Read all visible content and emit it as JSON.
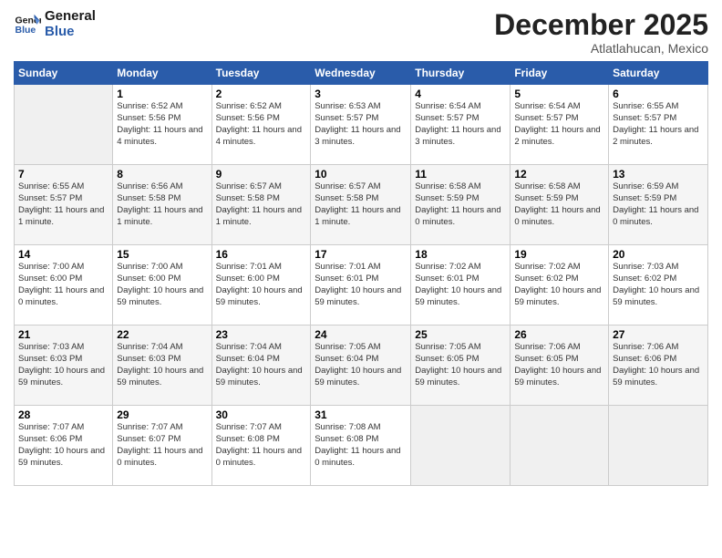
{
  "logo": {
    "line1": "General",
    "line2": "Blue"
  },
  "title": "December 2025",
  "subtitle": "Atlatlahucan, Mexico",
  "days_header": [
    "Sunday",
    "Monday",
    "Tuesday",
    "Wednesday",
    "Thursday",
    "Friday",
    "Saturday"
  ],
  "weeks": [
    [
      {
        "day": "",
        "sunrise": "",
        "sunset": "",
        "daylight": "",
        "empty": true
      },
      {
        "day": "1",
        "sunrise": "6:52 AM",
        "sunset": "5:56 PM",
        "daylight": "11 hours and 4 minutes.",
        "empty": false
      },
      {
        "day": "2",
        "sunrise": "6:52 AM",
        "sunset": "5:56 PM",
        "daylight": "11 hours and 4 minutes.",
        "empty": false
      },
      {
        "day": "3",
        "sunrise": "6:53 AM",
        "sunset": "5:57 PM",
        "daylight": "11 hours and 3 minutes.",
        "empty": false
      },
      {
        "day": "4",
        "sunrise": "6:54 AM",
        "sunset": "5:57 PM",
        "daylight": "11 hours and 3 minutes.",
        "empty": false
      },
      {
        "day": "5",
        "sunrise": "6:54 AM",
        "sunset": "5:57 PM",
        "daylight": "11 hours and 2 minutes.",
        "empty": false
      },
      {
        "day": "6",
        "sunrise": "6:55 AM",
        "sunset": "5:57 PM",
        "daylight": "11 hours and 2 minutes.",
        "empty": false
      }
    ],
    [
      {
        "day": "7",
        "sunrise": "6:55 AM",
        "sunset": "5:57 PM",
        "daylight": "11 hours and 1 minute.",
        "empty": false
      },
      {
        "day": "8",
        "sunrise": "6:56 AM",
        "sunset": "5:58 PM",
        "daylight": "11 hours and 1 minute.",
        "empty": false
      },
      {
        "day": "9",
        "sunrise": "6:57 AM",
        "sunset": "5:58 PM",
        "daylight": "11 hours and 1 minute.",
        "empty": false
      },
      {
        "day": "10",
        "sunrise": "6:57 AM",
        "sunset": "5:58 PM",
        "daylight": "11 hours and 1 minute.",
        "empty": false
      },
      {
        "day": "11",
        "sunrise": "6:58 AM",
        "sunset": "5:59 PM",
        "daylight": "11 hours and 0 minutes.",
        "empty": false
      },
      {
        "day": "12",
        "sunrise": "6:58 AM",
        "sunset": "5:59 PM",
        "daylight": "11 hours and 0 minutes.",
        "empty": false
      },
      {
        "day": "13",
        "sunrise": "6:59 AM",
        "sunset": "5:59 PM",
        "daylight": "11 hours and 0 minutes.",
        "empty": false
      }
    ],
    [
      {
        "day": "14",
        "sunrise": "7:00 AM",
        "sunset": "6:00 PM",
        "daylight": "11 hours and 0 minutes.",
        "empty": false
      },
      {
        "day": "15",
        "sunrise": "7:00 AM",
        "sunset": "6:00 PM",
        "daylight": "10 hours and 59 minutes.",
        "empty": false
      },
      {
        "day": "16",
        "sunrise": "7:01 AM",
        "sunset": "6:00 PM",
        "daylight": "10 hours and 59 minutes.",
        "empty": false
      },
      {
        "day": "17",
        "sunrise": "7:01 AM",
        "sunset": "6:01 PM",
        "daylight": "10 hours and 59 minutes.",
        "empty": false
      },
      {
        "day": "18",
        "sunrise": "7:02 AM",
        "sunset": "6:01 PM",
        "daylight": "10 hours and 59 minutes.",
        "empty": false
      },
      {
        "day": "19",
        "sunrise": "7:02 AM",
        "sunset": "6:02 PM",
        "daylight": "10 hours and 59 minutes.",
        "empty": false
      },
      {
        "day": "20",
        "sunrise": "7:03 AM",
        "sunset": "6:02 PM",
        "daylight": "10 hours and 59 minutes.",
        "empty": false
      }
    ],
    [
      {
        "day": "21",
        "sunrise": "7:03 AM",
        "sunset": "6:03 PM",
        "daylight": "10 hours and 59 minutes.",
        "empty": false
      },
      {
        "day": "22",
        "sunrise": "7:04 AM",
        "sunset": "6:03 PM",
        "daylight": "10 hours and 59 minutes.",
        "empty": false
      },
      {
        "day": "23",
        "sunrise": "7:04 AM",
        "sunset": "6:04 PM",
        "daylight": "10 hours and 59 minutes.",
        "empty": false
      },
      {
        "day": "24",
        "sunrise": "7:05 AM",
        "sunset": "6:04 PM",
        "daylight": "10 hours and 59 minutes.",
        "empty": false
      },
      {
        "day": "25",
        "sunrise": "7:05 AM",
        "sunset": "6:05 PM",
        "daylight": "10 hours and 59 minutes.",
        "empty": false
      },
      {
        "day": "26",
        "sunrise": "7:06 AM",
        "sunset": "6:05 PM",
        "daylight": "10 hours and 59 minutes.",
        "empty": false
      },
      {
        "day": "27",
        "sunrise": "7:06 AM",
        "sunset": "6:06 PM",
        "daylight": "10 hours and 59 minutes.",
        "empty": false
      }
    ],
    [
      {
        "day": "28",
        "sunrise": "7:07 AM",
        "sunset": "6:06 PM",
        "daylight": "10 hours and 59 minutes.",
        "empty": false
      },
      {
        "day": "29",
        "sunrise": "7:07 AM",
        "sunset": "6:07 PM",
        "daylight": "11 hours and 0 minutes.",
        "empty": false
      },
      {
        "day": "30",
        "sunrise": "7:07 AM",
        "sunset": "6:08 PM",
        "daylight": "11 hours and 0 minutes.",
        "empty": false
      },
      {
        "day": "31",
        "sunrise": "7:08 AM",
        "sunset": "6:08 PM",
        "daylight": "11 hours and 0 minutes.",
        "empty": false
      },
      {
        "day": "",
        "sunrise": "",
        "sunset": "",
        "daylight": "",
        "empty": true
      },
      {
        "day": "",
        "sunrise": "",
        "sunset": "",
        "daylight": "",
        "empty": true
      },
      {
        "day": "",
        "sunrise": "",
        "sunset": "",
        "daylight": "",
        "empty": true
      }
    ]
  ],
  "labels": {
    "sunrise_prefix": "Sunrise: ",
    "sunset_prefix": "Sunset: ",
    "daylight_prefix": "Daylight: "
  }
}
